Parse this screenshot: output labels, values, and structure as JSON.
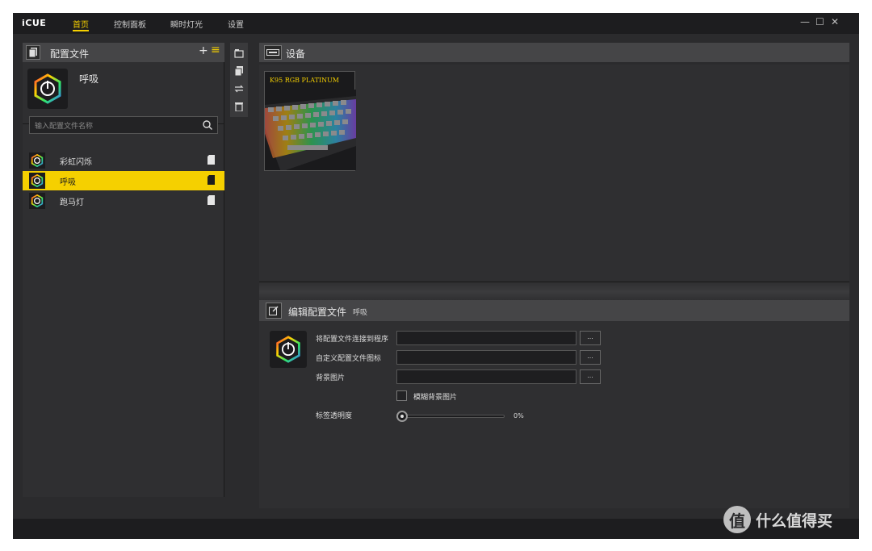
{
  "app": {
    "logo": "iCUE"
  },
  "nav": {
    "tabs": [
      {
        "label": "首页"
      },
      {
        "label": "控制面板"
      },
      {
        "label": "瞬时灯光"
      },
      {
        "label": "设置"
      }
    ]
  },
  "window": {
    "minimize": "—",
    "maximize": "☐",
    "close": "✕"
  },
  "profiles": {
    "header": "配置文件",
    "add_label": "+",
    "menu_label": "≡",
    "current": "呼吸",
    "search_placeholder": "输入配置文件名称",
    "items": [
      {
        "label": "彩虹闪烁"
      },
      {
        "label": "呼吸"
      },
      {
        "label": "跑马灯"
      }
    ]
  },
  "devices": {
    "header": "设备",
    "items": [
      {
        "name": "K95 RGB PLATINUM"
      }
    ]
  },
  "edit": {
    "header": "编辑配置文件",
    "profile_name": "呼吸",
    "link_program_label": "将配置文件连接到程序",
    "custom_icon_label": "自定义配置文件图标",
    "background_label": "背景图片",
    "blur_label": "模糊背景图片",
    "opacity_label": "标签透明度",
    "opacity_value": "0%",
    "browse": "...",
    "opacity_fraction": 0
  },
  "watermark": {
    "text": "什么值得买",
    "logo_char": "值"
  },
  "colors": {
    "accent": "#f5d000",
    "panel": "#2f2f31",
    "header": "#454547"
  }
}
